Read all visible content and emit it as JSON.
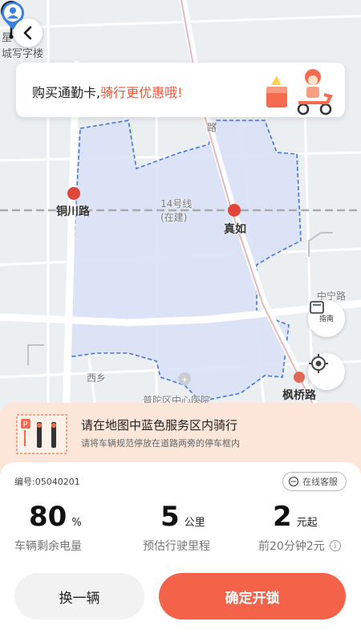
{
  "map": {
    "labels": {
      "top_left_1": "星",
      "top_left_2": "城写字楼",
      "station_tongchuan": "铜川路",
      "line14": "14号线",
      "line14_status": "(在建)",
      "station_zhenru": "真如",
      "road_right": "中宁路",
      "road_bottom": "西乡",
      "hospital": "普陀区中心医院",
      "station_fengqiao": "枫桥路",
      "road_top": "路"
    },
    "colors": {
      "service_area_fill": "#dde3f7",
      "service_area_border": "#3f6fd8",
      "metro_red": "#e0463a"
    }
  },
  "back_icon": "chevron-left-icon",
  "promo": {
    "text_prefix": "购买通勤卡,",
    "text_highlight": "骑行更优惠哦!"
  },
  "buttons": {
    "guide_label": "指南"
  },
  "notice": {
    "title": "请在地图中蓝色服务区内骑行",
    "subtitle": "请将车辆规范停放在道路两旁的停车框内"
  },
  "sheet": {
    "bike_id": "编号:05040201",
    "service": "在线客服",
    "stats": [
      {
        "value": "80",
        "unit": "%",
        "label": "车辆剩余电量"
      },
      {
        "value": "5",
        "unit": "公里",
        "label": "预估行驶里程"
      },
      {
        "value": "2",
        "unit": "元起",
        "label": "前20分钟2元"
      }
    ],
    "switch_label": "换一辆",
    "confirm_label": "确定开锁"
  },
  "accent_color": "#f4624a"
}
